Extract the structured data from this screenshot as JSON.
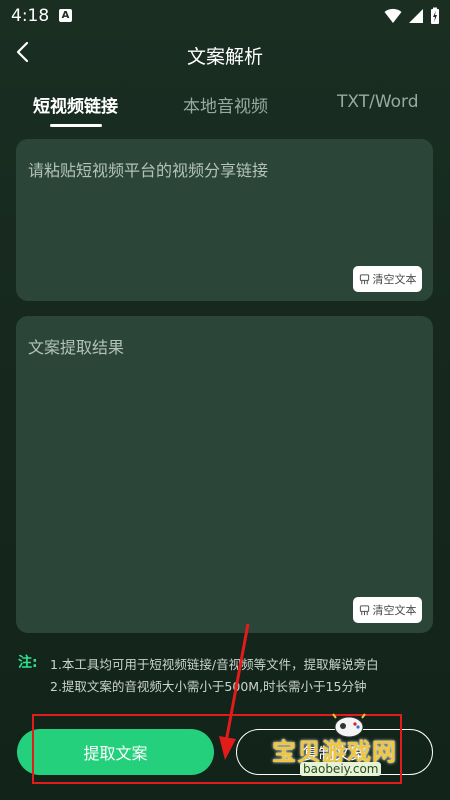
{
  "status": {
    "time": "4:18",
    "notification_badge": "A"
  },
  "header": {
    "title": "文案解析"
  },
  "tabs": [
    {
      "label": "短视频链接",
      "active": true
    },
    {
      "label": "本地音视频",
      "active": false
    },
    {
      "label": "TXT/Word",
      "active": false
    }
  ],
  "link_box": {
    "placeholder": "请粘贴短视频平台的视频分享链接",
    "clear_label": "清空文本"
  },
  "result_box": {
    "placeholder": "文案提取结果",
    "clear_label": "清空文本"
  },
  "notes": {
    "mark": "注:",
    "line1": "1.本工具均可用于短视频链接/音视频等文件，提取解说旁白",
    "line2": "2.提取文案的音视频大小需小于500M,时长需小于15分钟"
  },
  "actions": {
    "extract_label": "提取文案",
    "copy_label": "复制文案"
  },
  "watermark": {
    "title": "宝贝游戏网",
    "url": "baobeiy.com"
  },
  "colors": {
    "accent": "#25d07d",
    "background": "#1a2e22",
    "card": "#2b4638",
    "highlight": "#e21b1b",
    "note_mark": "#2fe08c"
  }
}
